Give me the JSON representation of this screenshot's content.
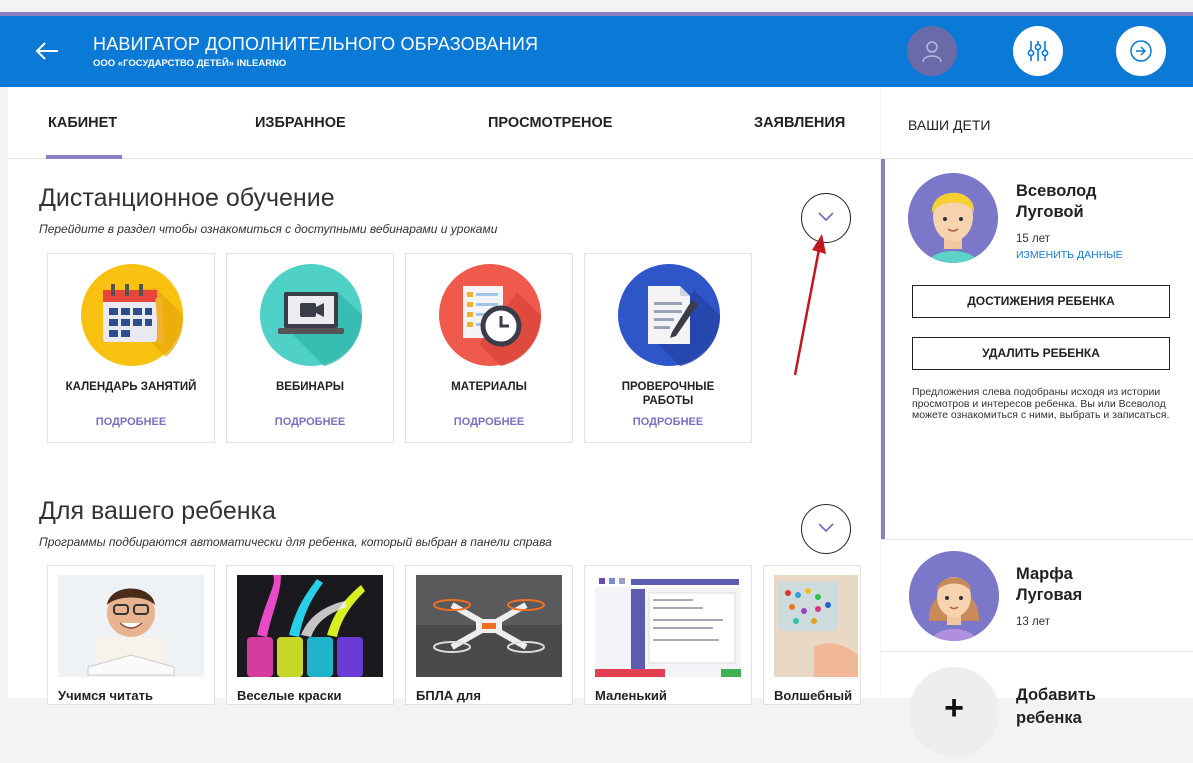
{
  "header": {
    "title": "НАВИГАТОР ДОПОЛНИТЕЛЬНОГО ОБРАЗОВАНИЯ",
    "subtitle": "ООО «ГОСУДАРСТВО ДЕТЕЙ» INLEARNO"
  },
  "tabs": [
    "КАБИНЕТ",
    "ИЗБРАННОЕ",
    "ПРОСМОТРЕНОЕ",
    "ЗАЯВЛЕНИЯ"
  ],
  "distance": {
    "title": "Дистанционное обучение",
    "subtitle": "Перейдите в раздел чтобы ознакомиться с доступными вебинарами и уроками",
    "cards": [
      {
        "label": "КАЛЕНДАРЬ ЗАНЯТИЙ",
        "more": "ПОДРОБНЕЕ",
        "icon": "calendar-icon"
      },
      {
        "label": "ВЕБИНАРЫ",
        "more": "ПОДРОБНЕЕ",
        "icon": "webinar-laptop-icon"
      },
      {
        "label": "МАТЕРИАЛЫ",
        "more": "ПОДРОБНЕЕ",
        "icon": "materials-clock-icon"
      },
      {
        "label": "ПРОВЕРОЧНЫЕ РАБОТЫ",
        "more": "ПОДРОБНЕЕ",
        "icon": "test-document-icon"
      }
    ]
  },
  "forchild": {
    "title": "Для вашего ребенка",
    "subtitle": "Программы подбираются автоматически для ребенка, который выбран в панели справа",
    "programs": [
      "Учимся читать",
      "Веселые краски",
      "БПЛА для",
      "Маленький",
      "Волшебный"
    ]
  },
  "sidebar": {
    "heading": "ВАШИ ДЕТИ",
    "child1": {
      "first": "Всеволод",
      "last": "Луговой",
      "age": "15 лет",
      "edit": "ИЗМЕНИТЬ ДАННЫЕ",
      "btn_achievements": "ДОСТИЖЕНИЯ РЕБЕНКА",
      "btn_delete": "УДАЛИТЬ РЕБЕНКА",
      "note": "Предложения слева подобраны исходя из истории просмотров и интересов ребенка. Вы или Всеволод можете ознакомиться с ними, выбрать и записаться."
    },
    "child2": {
      "first": "Марфа",
      "last": "Луговая",
      "age": "13 лет"
    },
    "add": {
      "plus": "+",
      "line1": "Добавить",
      "line2": "ребенка"
    }
  },
  "colors": {
    "header_blue": "#0a7ad6",
    "accent_purple": "#8a7fc4",
    "link_blue": "#1778d6",
    "arrow_red": "#c0181e"
  }
}
